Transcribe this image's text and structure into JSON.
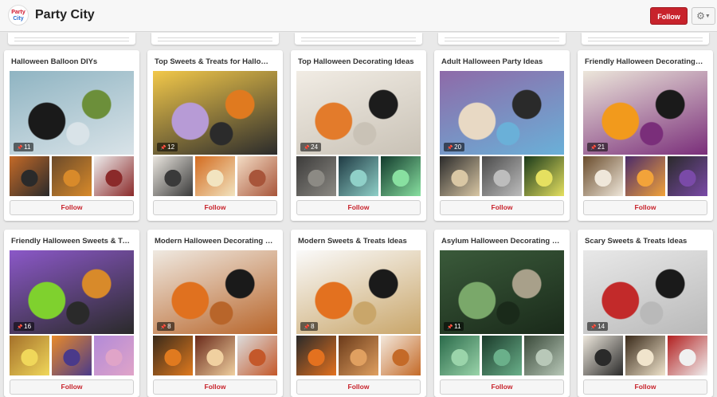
{
  "header": {
    "logo_line1": "Party",
    "logo_line2": "City",
    "title": "Party City",
    "follow_label": "Follow",
    "settings_icon": "gear-icon"
  },
  "follow_label": "Follow",
  "boards": [
    {
      "title": "Halloween Balloon DIYs",
      "pins": "11",
      "cover": [
        "#8fb4c2",
        "#1a1a1a",
        "#6c8f3a",
        "#d9e3e8"
      ],
      "thumbs": [
        [
          "#c46a28",
          "#2a2a2a"
        ],
        [
          "#6b4a2a",
          "#d88a2a"
        ],
        [
          "#eeeeee",
          "#8b2a2a"
        ]
      ]
    },
    {
      "title": "Top Sweets & Treats for Halloween",
      "pins": "12",
      "cover": [
        "#f2c84a",
        "#b79bd6",
        "#e07a1f",
        "#2b2b2b"
      ],
      "thumbs": [
        [
          "#eae6df",
          "#3a3a3a"
        ],
        [
          "#d36b1f",
          "#f2e4c0"
        ],
        [
          "#f3dcc4",
          "#a8553a"
        ]
      ]
    },
    {
      "title": "Top Halloween Decorating Ideas",
      "pins": "24",
      "cover": [
        "#f1ece4",
        "#e37b2b",
        "#1c1c1c",
        "#c9c2b6"
      ],
      "thumbs": [
        [
          "#3c3b3a",
          "#8c8a84"
        ],
        [
          "#1f3a43",
          "#8fd0c8"
        ],
        [
          "#123a2c",
          "#88e0a0"
        ]
      ]
    },
    {
      "title": "Adult Halloween Party Ideas",
      "pins": "20",
      "cover": [
        "#8e6aa8",
        "#e8d9c4",
        "#2a2a2a",
        "#6ab0d8"
      ],
      "thumbs": [
        [
          "#2a2a2a",
          "#d9c7a4"
        ],
        [
          "#4a4a4a",
          "#bdbdbd"
        ],
        [
          "#1a3a1a",
          "#e5e060"
        ]
      ]
    },
    {
      "title": "Friendly Halloween Decorating Ideas",
      "pins": "21",
      "cover": [
        "#ece6da",
        "#f29a1c",
        "#1a1a1a",
        "#7a2e7a"
      ],
      "thumbs": [
        [
          "#6a4c2c",
          "#efe7da"
        ],
        [
          "#4a2a6a",
          "#f2a33a"
        ],
        [
          "#2a2a2a",
          "#7a4aa8"
        ]
      ]
    },
    {
      "title": "Friendly Halloween Sweets & Treats",
      "pins": "16",
      "cover": [
        "#8b58c8",
        "#7fd12e",
        "#d88a2a",
        "#2a2a2a"
      ],
      "thumbs": [
        [
          "#a4702a",
          "#f0d75a"
        ],
        [
          "#e88a2a",
          "#4a3a8a"
        ],
        [
          "#b28ad8",
          "#e0a4c8"
        ]
      ]
    },
    {
      "title": "Modern Halloween Decorating Ideas",
      "pins": "8",
      "cover": [
        "#efe9e1",
        "#e0711f",
        "#1a1a1a",
        "#b8652a"
      ],
      "thumbs": [
        [
          "#3a2a1a",
          "#e07a1f"
        ],
        [
          "#6a2a1a",
          "#f0d0a0"
        ],
        [
          "#dcdcdc",
          "#c4582a"
        ]
      ]
    },
    {
      "title": "Modern Sweets & Treats Ideas",
      "pins": "8",
      "cover": [
        "#fafafa",
        "#e3711f",
        "#1a1a1a",
        "#c9a66a"
      ],
      "thumbs": [
        [
          "#2a2a2a",
          "#e3711f"
        ],
        [
          "#6a3a1a",
          "#e0a060"
        ],
        [
          "#f3e8dc",
          "#c46a28"
        ]
      ]
    },
    {
      "title": "Asylum Halloween Decorating Ideas",
      "pins": "11",
      "cover": [
        "#3a5a3a",
        "#7aa86a",
        "#a8a08a",
        "#1a2a1a"
      ],
      "thumbs": [
        [
          "#2a6a4a",
          "#9ad4aa"
        ],
        [
          "#1a3a2a",
          "#6ab08a"
        ],
        [
          "#3a4a3a",
          "#b8c8b8"
        ]
      ]
    },
    {
      "title": "Scary Sweets & Treats Ideas",
      "pins": "14",
      "cover": [
        "#e8e8e8",
        "#c22a2a",
        "#1a1a1a",
        "#b9b9b9"
      ],
      "thumbs": [
        [
          "#ede7dc",
          "#2a2a2a"
        ],
        [
          "#3a2a1a",
          "#f0e4cc"
        ],
        [
          "#b22020",
          "#f0f0f0"
        ]
      ]
    }
  ]
}
